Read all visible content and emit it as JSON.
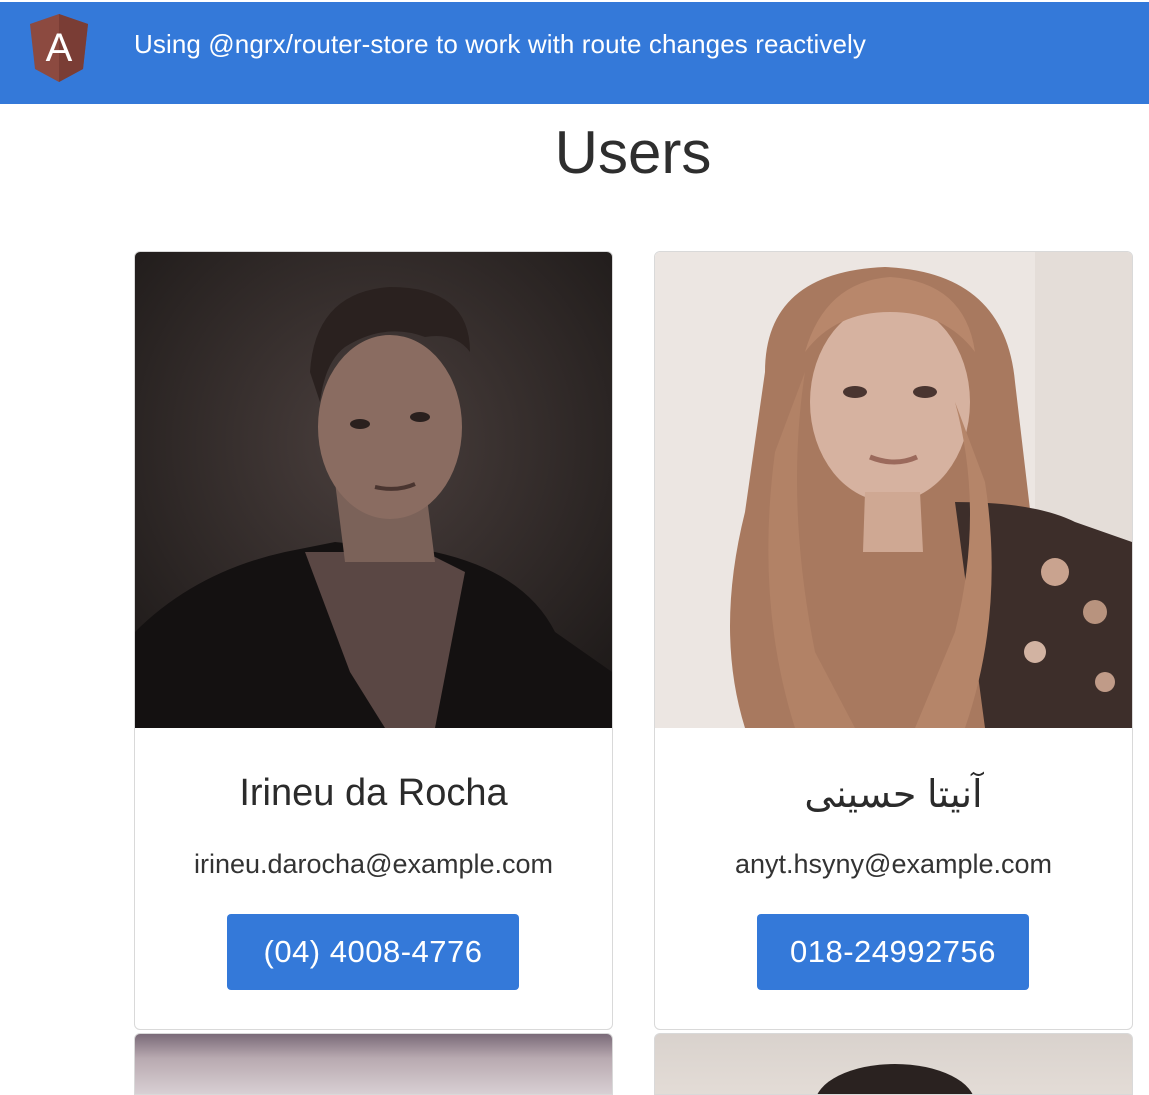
{
  "navbar": {
    "logo_letter": "A",
    "title": "Using @ngrx/router-store to work with route changes reactively",
    "brand_color": "#3479d9"
  },
  "page": {
    "title": "Users"
  },
  "users": [
    {
      "name": "Irineu da Rocha",
      "email": "irineu.darocha@example.com",
      "phone": "(04) 4008-4776"
    },
    {
      "name": "آنیتا حسینی",
      "email": "anyt.hsyny@example.com",
      "phone": "018-24992756"
    }
  ],
  "colors": {
    "accent": "#3479d9",
    "card_border": "#d9d9d9",
    "logo_shield": "#8c4a40"
  }
}
